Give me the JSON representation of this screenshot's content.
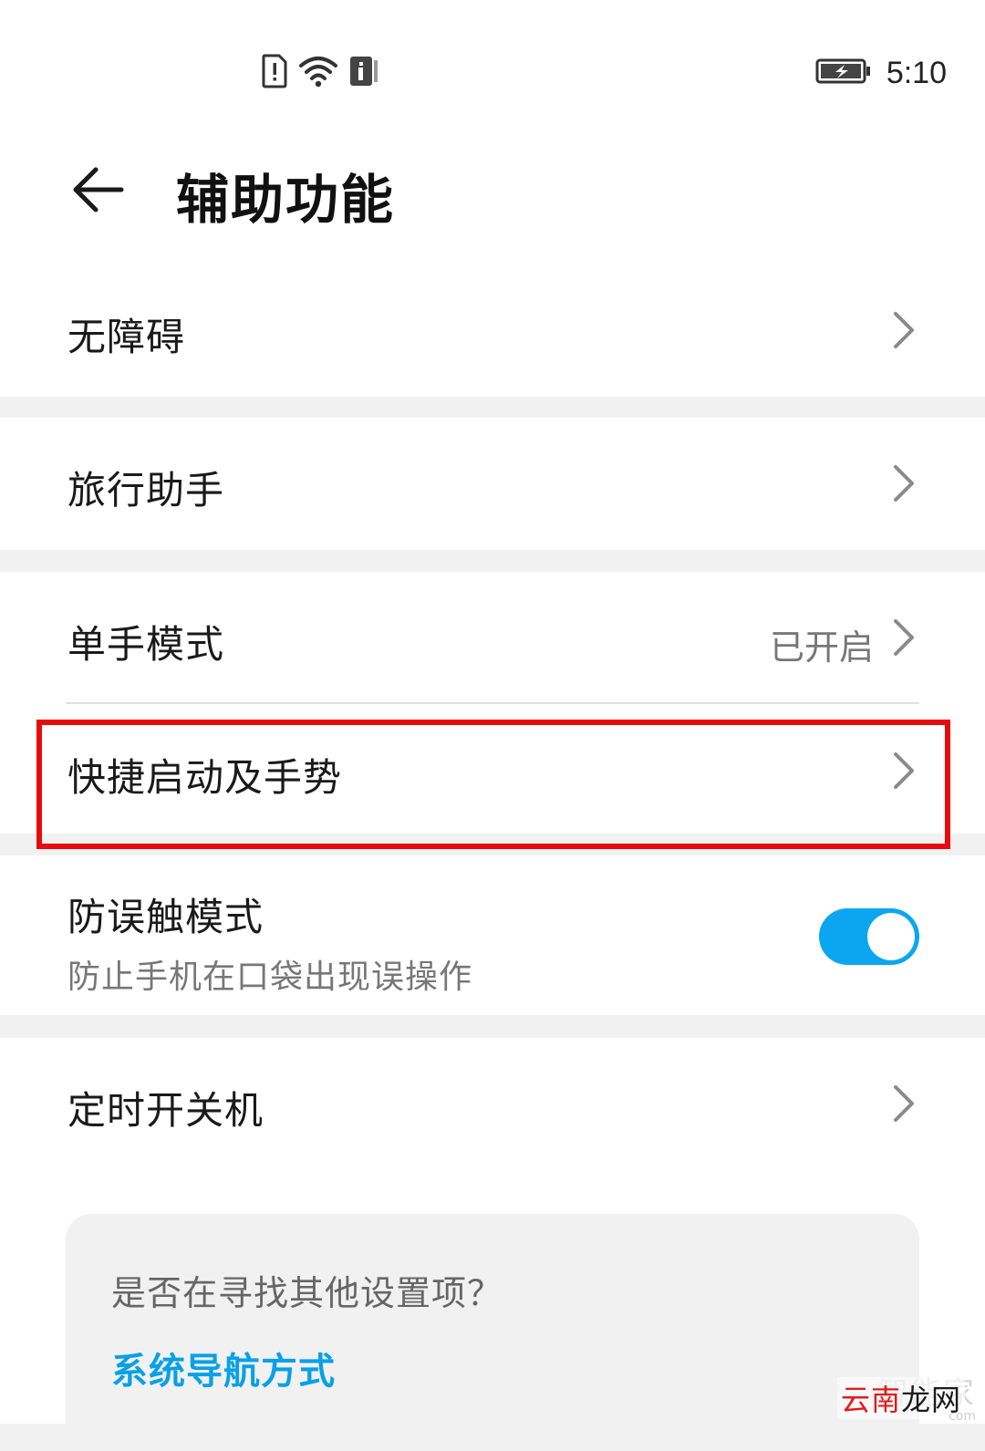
{
  "status_bar": {
    "time": "5:10",
    "icons": [
      "sim-alert-icon",
      "wifi-icon",
      "info-icon",
      "battery-charging-icon"
    ]
  },
  "header": {
    "title": "辅助功能",
    "back_icon": "back-arrow-icon"
  },
  "items": {
    "accessibility": {
      "label": "无障碍"
    },
    "travel_assistant": {
      "label": "旅行助手"
    },
    "one_hand_mode": {
      "label": "单手模式",
      "value": "已开启"
    },
    "shortcuts_gestures": {
      "label": "快捷启动及手势"
    },
    "pocket_mode": {
      "label": "防误触模式",
      "subtitle": "防止手机在口袋出现误操作",
      "enabled": true
    },
    "scheduled_power": {
      "label": "定时开关机"
    }
  },
  "suggestion": {
    "title": "是否在寻找其他设置项？",
    "link": "系统导航方式"
  },
  "watermark": {
    "top_text": "智能家",
    "text_red": "云南",
    "text_black": "龙网",
    "sub": "com"
  },
  "colors": {
    "accent": "#0aa0e6",
    "toggle_on": "#0ba6ef",
    "highlight": "#e80b0b",
    "background": "#f1f1f1"
  }
}
